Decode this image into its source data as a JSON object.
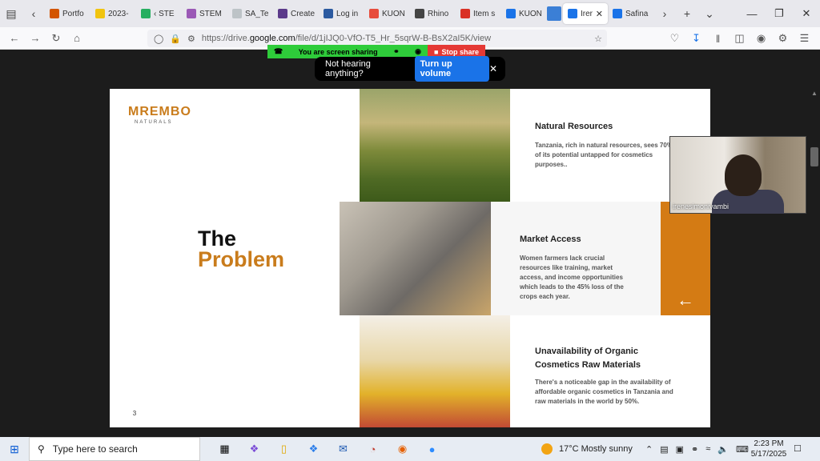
{
  "browser": {
    "tabs": [
      {
        "label": "Portfo",
        "fav_color": "#d35400"
      },
      {
        "label": "2023-",
        "fav_color": "#f1c40f"
      },
      {
        "label": "‹ STE",
        "fav_color": "#27ae60"
      },
      {
        "label": "STEM",
        "fav_color": "#9b59b6"
      },
      {
        "label": "SA_Te",
        "fav_color": "#bdc3c7"
      },
      {
        "label": "Create",
        "fav_color": "#5b3a8a"
      },
      {
        "label": "Log in",
        "fav_color": "#2c5aa0"
      },
      {
        "label": "KUON",
        "fav_color": "#e74c3c"
      },
      {
        "label": "Rhino",
        "fav_color": "#444444"
      },
      {
        "label": "Item s",
        "fav_color": "#d93025"
      },
      {
        "label": "KUON",
        "fav_color": "#1a73e8"
      },
      {
        "label": "",
        "fav_color": "#3b7fd6"
      },
      {
        "label": "Irer",
        "fav_color": "#1a73e8",
        "active": true
      },
      {
        "label": "Safina",
        "fav_color": "#1a73e8"
      }
    ],
    "url_prefix": "https://drive.",
    "url_domain": "google.com",
    "url_suffix": "/file/d/1jIJQ0-VfO-T5_Hr_5sqrW-B-BsX2aI5K/view"
  },
  "share": {
    "sharing_label": "You are screen sharing",
    "stop_label": "Stop share",
    "hearing_text": "Not hearing anything?",
    "volume_button": "Turn up volume",
    "close_glyph": "✕"
  },
  "slide": {
    "logo_main": "MREMBO",
    "logo_sub": "NATURALS",
    "title_line1": "The",
    "title_line2": "Problem",
    "page_number": "3",
    "sections": [
      {
        "title": "Natural Resources",
        "text": "Tanzania, rich in natural resources, sees 70% of its potential untapped for cosmetics purposes.."
      },
      {
        "title": "Market Access",
        "text": "Women farmers lack crucial resources like training, market access, and income opportunities which leads to the 45% loss of the crops each year."
      },
      {
        "title": "Unavailability of Organic Cosmetics Raw Materials",
        "text": "There's a noticeable gap in the availability of affordable organic cosmetics in Tanzania and raw materials in the world by 50%."
      }
    ],
    "accent_color": "#d47b14"
  },
  "video": {
    "participant_name": "irenesimonivambi"
  },
  "taskbar": {
    "search_placeholder": "Type here to search",
    "weather": "17°C  Mostly sunny",
    "time": "2:23 PM",
    "date": "5/17/2025"
  }
}
